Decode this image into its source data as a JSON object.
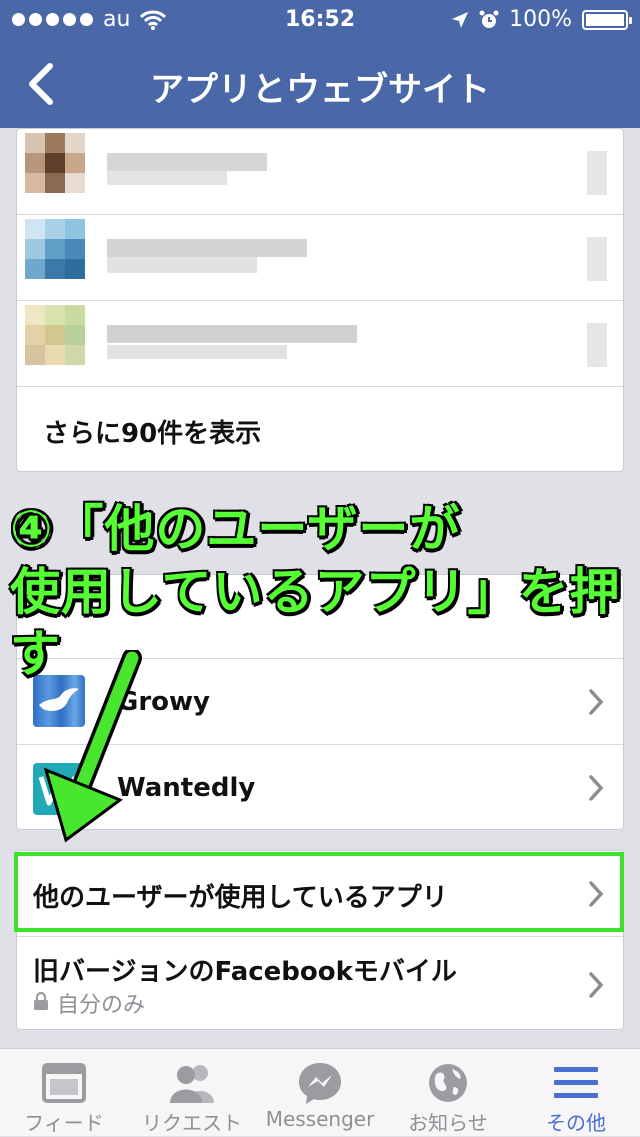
{
  "status_bar": {
    "carrier": "au",
    "time": "16:52",
    "battery": "100%",
    "battery_level": 1.0
  },
  "nav": {
    "title": "アプリとウェブサイト"
  },
  "top_list": {
    "show_more": "さらに90件を表示"
  },
  "annotation": {
    "line1": "④「他のユーザーが",
    "line2": "使用しているアプリ」を押す"
  },
  "apps": [
    {
      "name": "Growy",
      "icon": "growy-bird-icon"
    },
    {
      "name": "Wantedly",
      "icon": "wantedly-w-icon"
    }
  ],
  "settings": {
    "others_apps": "他のユーザーが使用しているアプリ",
    "old_mobile": "旧バージョンのFacebookモバイル",
    "old_mobile_privacy": "自分のみ"
  },
  "tabs": [
    {
      "label": "フィード",
      "icon": "feed-icon"
    },
    {
      "label": "リクエスト",
      "icon": "friend-requests-icon"
    },
    {
      "label": "Messenger",
      "icon": "messenger-icon"
    },
    {
      "label": "お知らせ",
      "icon": "globe-notifications-icon"
    },
    {
      "label": "その他",
      "icon": "menu-icon"
    }
  ],
  "colors": {
    "nav": "#4a67a8",
    "annotation": "#55ff34",
    "highlight_box": "#3de22a",
    "active_tab": "#4a6fd0"
  }
}
